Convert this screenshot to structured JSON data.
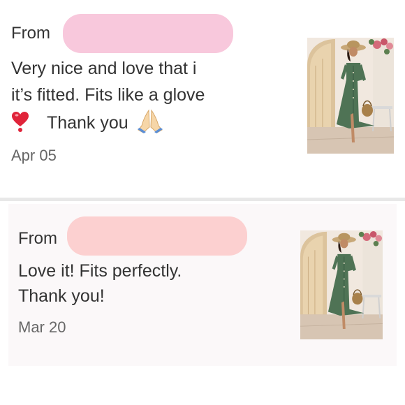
{
  "reviews": [
    {
      "from_label": "From",
      "line1": "Very nice and love that i",
      "line2": "it’s fitted. Fits like a glove",
      "line3": "Thank you",
      "date": "Apr 05",
      "icons": [
        "heart-icon",
        "folded-hands-icon"
      ],
      "redaction_color": "#f8c8dc"
    },
    {
      "from_label": "From",
      "line1": "Love it! Fits perfectly.",
      "line2": "Thank you!",
      "date": "Mar 20",
      "redaction_color": "#fcd0d0"
    }
  ],
  "colors": {
    "text": "#333333",
    "date": "#666666",
    "divider": "#e8e8e8",
    "dress": "#4f7355"
  }
}
